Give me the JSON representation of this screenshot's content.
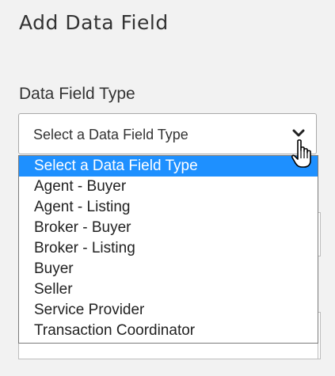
{
  "dialog": {
    "title": "Add Data Field"
  },
  "data_field_type": {
    "label": "Data Field Type",
    "selected_value": "Select a Data Field Type",
    "options": [
      "Select a Data Field Type",
      "Agent - Buyer",
      "Agent - Listing",
      "Broker - Buyer",
      "Broker - Listing",
      "Buyer",
      "Seller",
      "Service Provider",
      "Transaction Coordinator"
    ],
    "highlighted_index": 0
  },
  "icons": {
    "dropdown_arrow": "chevron-down-icon",
    "cursor": "hand-pointer-icon"
  },
  "colors": {
    "highlight": "#1e90ff",
    "page_background": "#f2f2f2",
    "text": "#333333"
  }
}
